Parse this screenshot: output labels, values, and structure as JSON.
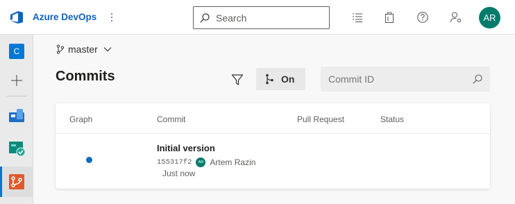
{
  "topbar": {
    "brand": "Azure DevOps",
    "search_placeholder": "Search",
    "avatar_initials": "AR"
  },
  "rail": {
    "project_initial": "C"
  },
  "repo": {
    "branch": "master",
    "page_title": "Commits",
    "graph_toggle_label": "On",
    "commit_search_placeholder": "Commit ID"
  },
  "table": {
    "columns": [
      "Graph",
      "Commit",
      "Pull Request",
      "Status"
    ],
    "rows": [
      {
        "title": "Initial version",
        "hash": "155317f2",
        "author_initials": "AR",
        "author": "Artem Razin",
        "time": "Just now"
      }
    ]
  },
  "colors": {
    "brand": "#0f63bd",
    "accent": "#0078d4",
    "avatar": "#007c6b",
    "graph_dot": "#0f6cbd"
  }
}
